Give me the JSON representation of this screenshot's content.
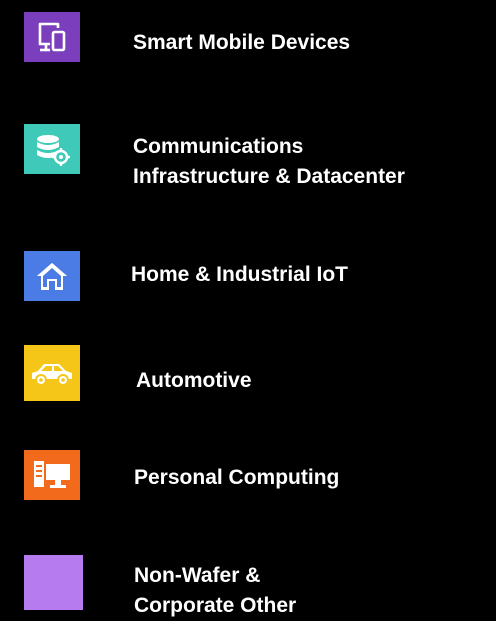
{
  "legend": [
    {
      "lines": [
        "Smart Mobile Devices"
      ],
      "icon": "devices-icon",
      "color": "#7B3FBE"
    },
    {
      "lines": [
        "Communications",
        "Infrastructure & Datacenter"
      ],
      "icon": "database-gear-icon",
      "color": "#3EC9B8"
    },
    {
      "lines": [
        "Home & Industrial IoT"
      ],
      "icon": "home-icon",
      "color": "#4B7BE5"
    },
    {
      "lines": [
        "Automotive"
      ],
      "icon": "car-icon",
      "color": "#F5C518"
    },
    {
      "lines": [
        "Personal Computing"
      ],
      "icon": "desktop-computer-icon",
      "color": "#F26A1B"
    },
    {
      "lines": [
        "Non-Wafer &",
        "Corporate Other"
      ],
      "icon": "",
      "color": "#B57BEF"
    }
  ]
}
